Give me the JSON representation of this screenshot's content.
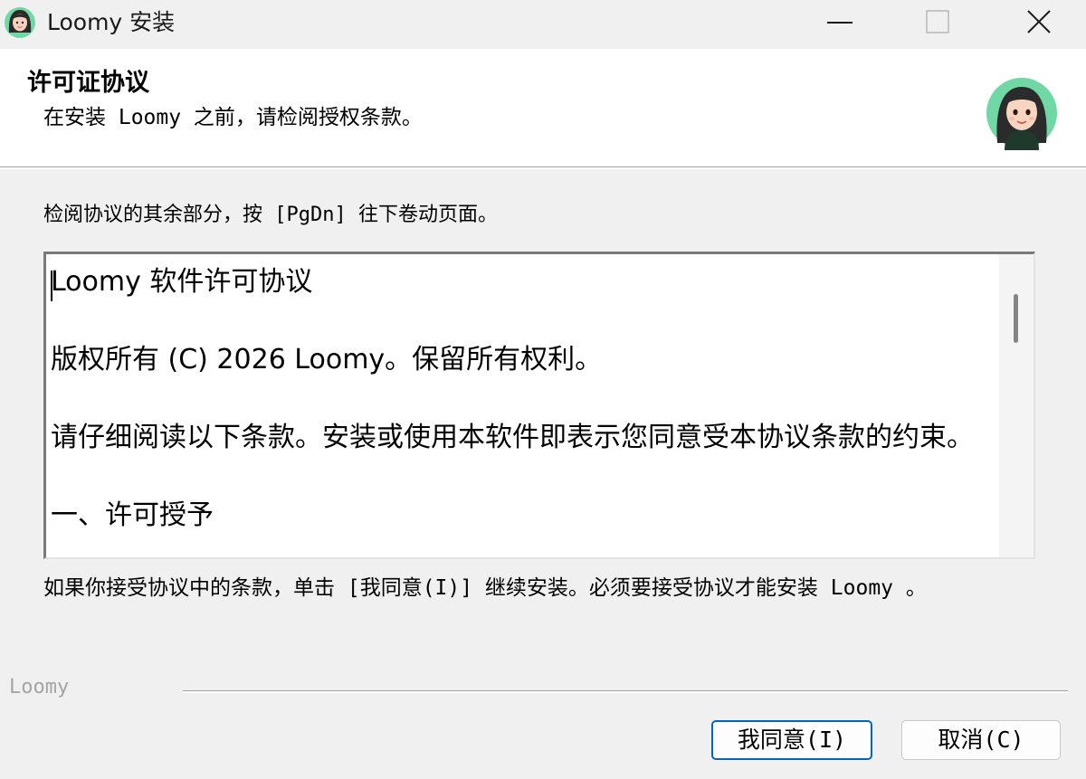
{
  "window": {
    "title": "Loomy 安装",
    "controls": {
      "minimize": "minimize-icon",
      "maximize": "maximize-icon",
      "close": "close-icon"
    }
  },
  "header": {
    "title": "许可证协议",
    "subtitle": "在安装 Loomy 之前，请检阅授权条款。"
  },
  "instruction": "检阅协议的其余部分，按 [PgDn] 往下卷动页面。",
  "license": {
    "paragraphs": [
      "Loomy 软件许可协议",
      "版权所有 (C) 2026 Loomy。保留所有权利。",
      "请仔细阅读以下条款。安装或使用本软件即表示您同意受本协议条款的约束。",
      "一、许可授予"
    ]
  },
  "accept_text": "如果你接受协议中的条款，单击 [我同意(I)] 继续安装。必须要接受协议才能安装 Loomy 。",
  "brand": "Loomy",
  "buttons": {
    "agree": "我同意(I)",
    "cancel": "取消(C)"
  },
  "colors": {
    "accent": "#0067c0",
    "avatar_bg": "#6fd8a4"
  }
}
